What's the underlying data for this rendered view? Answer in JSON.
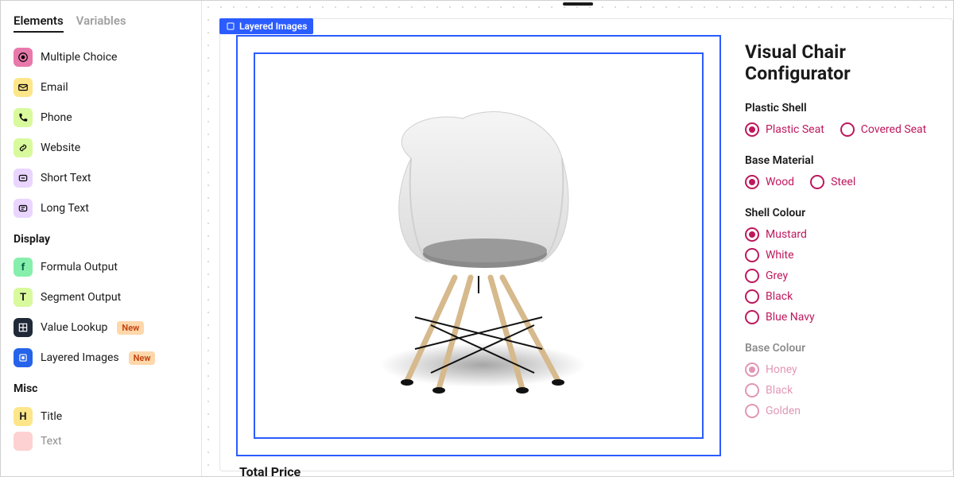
{
  "tabs": {
    "elements": "Elements",
    "variables": "Variables"
  },
  "sidebar": {
    "items_top": [
      {
        "label": "Multiple Choice",
        "icon": "radio-dot",
        "bg": "pink"
      },
      {
        "label": "Email",
        "icon": "mail",
        "bg": "yellow"
      },
      {
        "label": "Phone",
        "icon": "phone",
        "bg": "lime"
      },
      {
        "label": "Website",
        "icon": "link",
        "bg": "lime"
      },
      {
        "label": "Short Text",
        "icon": "text",
        "bg": "purple"
      },
      {
        "label": "Long Text",
        "icon": "text",
        "bg": "purple"
      }
    ],
    "section_display": "Display",
    "items_display": [
      {
        "label": "Formula Output",
        "icon": "fx",
        "bg": "green"
      },
      {
        "label": "Segment Output",
        "icon": "t",
        "bg": "lime2"
      },
      {
        "label": "Value Lookup",
        "icon": "grid",
        "bg": "dark",
        "badge": "New"
      },
      {
        "label": "Layered Images",
        "icon": "frame",
        "bg": "blue",
        "badge": "New"
      }
    ],
    "section_misc": "Misc",
    "items_misc": [
      {
        "label": "Title",
        "icon": "h",
        "bg": "yellow"
      }
    ],
    "peek_label": "Text"
  },
  "canvas": {
    "selected_label": "Layered Images",
    "total_label": "Total Price"
  },
  "config": {
    "title": "Visual Chair Configurator",
    "groups": [
      {
        "title": "Plastic Shell",
        "layout": "row",
        "options": [
          {
            "label": "Plastic Seat",
            "checked": true
          },
          {
            "label": "Covered Seat",
            "checked": false
          }
        ]
      },
      {
        "title": "Base Material",
        "layout": "row",
        "options": [
          {
            "label": "Wood",
            "checked": true
          },
          {
            "label": "Steel",
            "checked": false
          }
        ]
      },
      {
        "title": "Shell Colour",
        "layout": "col",
        "options": [
          {
            "label": "Mustard",
            "checked": true
          },
          {
            "label": "White",
            "checked": false
          },
          {
            "label": "Grey",
            "checked": false
          },
          {
            "label": "Black",
            "checked": false
          },
          {
            "label": "Blue Navy",
            "checked": false
          }
        ]
      },
      {
        "title": "Base Colour",
        "layout": "col",
        "muted": true,
        "options": [
          {
            "label": "Honey",
            "checked": true
          },
          {
            "label": "Black",
            "checked": false
          },
          {
            "label": "Golden",
            "checked": false
          }
        ]
      }
    ]
  }
}
